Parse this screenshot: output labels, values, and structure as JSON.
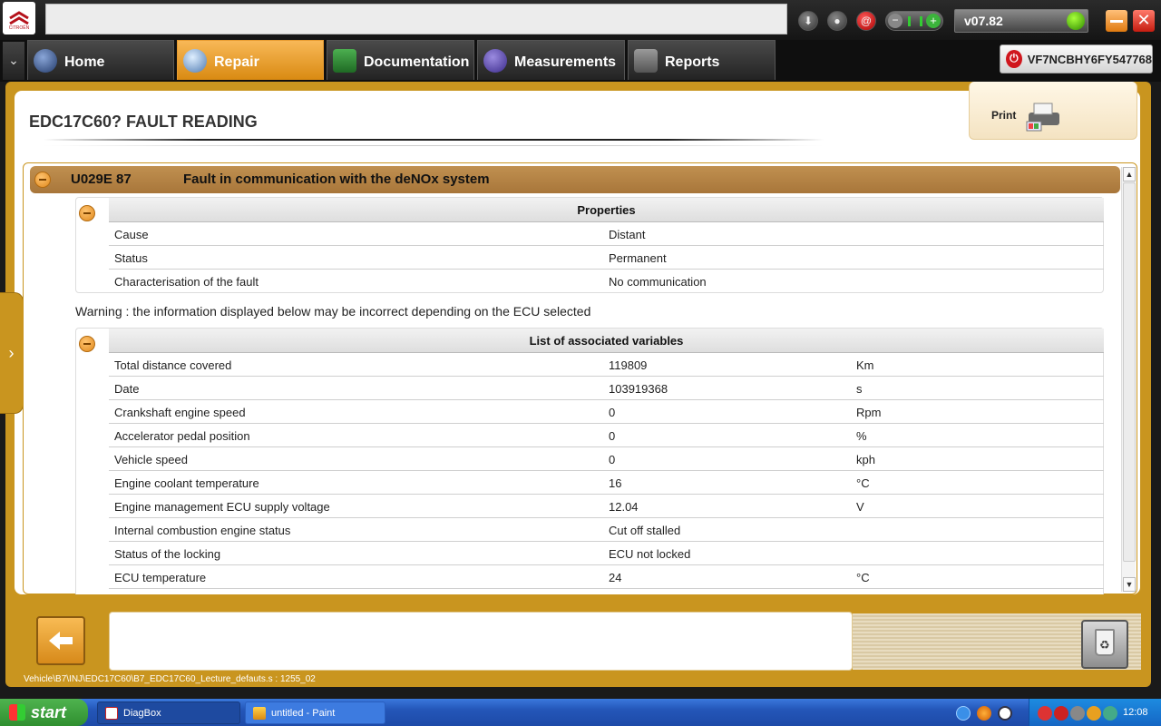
{
  "app": {
    "version": "v07.82",
    "vin": "VF7NCBHY6FY547768",
    "logo_text": "CITROËN"
  },
  "nav": {
    "tabs": [
      {
        "label": "Home",
        "icon": "home-icon"
      },
      {
        "label": "Repair",
        "icon": "magnifier-icon",
        "active": true
      },
      {
        "label": "Documentation",
        "icon": "book-icon"
      },
      {
        "label": "Measurements",
        "icon": "wave-icon"
      },
      {
        "label": "Reports",
        "icon": "report-icon"
      }
    ]
  },
  "page": {
    "title": "EDC17C60?  FAULT READING",
    "print_label": "Print"
  },
  "fault": {
    "code": "U029E 87",
    "description": "Fault in communication with the deNOx system"
  },
  "properties": {
    "header": "Properties",
    "rows": [
      {
        "name": "Cause",
        "value": "Distant"
      },
      {
        "name": "Status",
        "value": "Permanent"
      },
      {
        "name": "Characterisation of the fault",
        "value": "No communication"
      }
    ]
  },
  "warning": "Warning : the information displayed below may be incorrect depending on the ECU selected",
  "variables": {
    "header": "List of associated variables",
    "rows": [
      {
        "name": "Total distance covered",
        "value": "119809",
        "unit": "Km"
      },
      {
        "name": "Date",
        "value": "103919368",
        "unit": "s"
      },
      {
        "name": "Crankshaft engine speed",
        "value": "0",
        "unit": "Rpm"
      },
      {
        "name": "Accelerator pedal position",
        "value": "0",
        "unit": "%"
      },
      {
        "name": "Vehicle speed",
        "value": "0",
        "unit": "kph"
      },
      {
        "name": "Engine coolant temperature",
        "value": "16",
        "unit": "°C"
      },
      {
        "name": "Engine management ECU supply voltage",
        "value": "12.04",
        "unit": "V"
      },
      {
        "name": "Internal combustion engine status",
        "value": "Cut off stalled",
        "unit": ""
      },
      {
        "name": "Status of the locking",
        "value": "ECU not locked",
        "unit": ""
      },
      {
        "name": "ECU temperature",
        "value": "24",
        "unit": "°C"
      }
    ]
  },
  "footer": {
    "path": "Vehicle\\B7\\INJ\\EDC17C60\\B7_EDC17C60_Lecture_defauts.s : 1255_02"
  },
  "taskbar": {
    "start": "start",
    "tasks": [
      {
        "label": "DiagBox"
      },
      {
        "label": "untitled - Paint"
      }
    ],
    "clock": "12:08"
  },
  "colors": {
    "accent": "#c9951f",
    "active_tab": "#f0a030",
    "fault_header": "#b07e40"
  }
}
